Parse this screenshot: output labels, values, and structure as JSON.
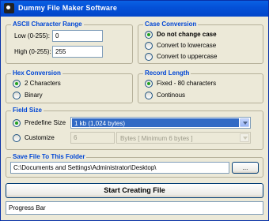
{
  "window": {
    "title": "Dummy File Maker Software",
    "icon": "app-icon"
  },
  "ascii_range": {
    "title": "ASCII Character Range",
    "low_label": "Low (0-255):",
    "low_value": "0",
    "high_label": "High (0-255):",
    "high_value": "255"
  },
  "case_conversion": {
    "title": "Case Conversion",
    "options": [
      "Do not change case",
      "Convert to lowercase",
      "Convert to uppercase"
    ],
    "selected": 0
  },
  "hex_conversion": {
    "title": "Hex Conversion",
    "options": [
      "2 Characters",
      "Binary"
    ],
    "selected": 0
  },
  "record_length": {
    "title": "Record Length",
    "options": [
      "Fixed - 80 characters",
      "Continous"
    ],
    "selected": 0
  },
  "field_size": {
    "title": "Field Size",
    "predefine_label": "Predefine Size",
    "predefine_value": "1 kb (1,024 bytes)",
    "customize_label": "Customize",
    "customize_value": "6",
    "unit_value": "Bytes [ Minimum 6 bytes ]",
    "selected": "predefine"
  },
  "save_folder": {
    "title": "Save File To This Folder",
    "path": "C:\\Documents and Settings\\Administrator\\Desktop\\",
    "browse_label": "..."
  },
  "actions": {
    "start_label": "Start Creating File"
  },
  "progress": {
    "label": "Progress Bar"
  }
}
